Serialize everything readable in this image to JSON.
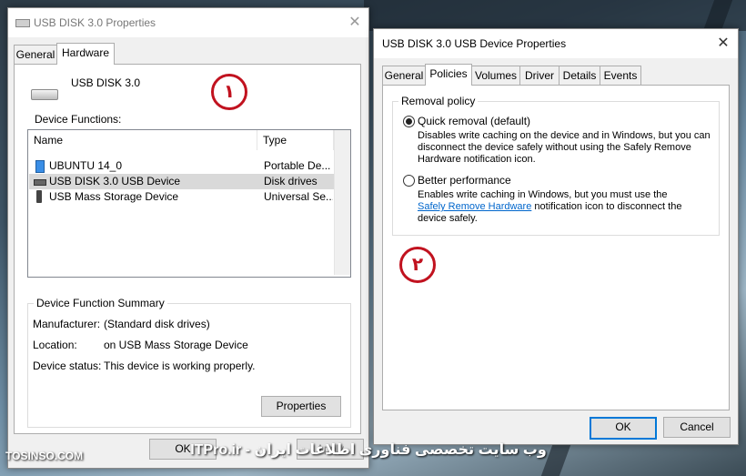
{
  "left_window": {
    "title": "USB DISK 3.0 Properties",
    "tabs": [
      "General",
      "Hardware"
    ],
    "device_name": "USB DISK 3.0",
    "device_functions_label": "Device Functions:",
    "columns": [
      "Name",
      "Type"
    ],
    "rows": [
      {
        "name": "UBUNTU 14_0",
        "type": "Portable De..."
      },
      {
        "name": "USB DISK 3.0 USB Device",
        "type": "Disk drives"
      },
      {
        "name": "USB Mass Storage Device",
        "type": "Universal Se..."
      }
    ],
    "summary_title": "Device Function Summary",
    "summary": [
      {
        "key": "Manufacturer:",
        "value": "(Standard disk drives)"
      },
      {
        "key": "Location:",
        "value": "on USB Mass Storage Device"
      },
      {
        "key": "Device status:",
        "value": "This device is working properly."
      }
    ],
    "properties_button": "Properties",
    "ok_button": "OK",
    "apply_button": "Apply"
  },
  "right_window": {
    "title": "USB DISK 3.0 USB Device Properties",
    "tabs": [
      "General",
      "Policies",
      "Volumes",
      "Driver",
      "Details",
      "Events"
    ],
    "removal_policy_label": "Removal policy",
    "quick_removal_label": "Quick removal (default)",
    "quick_removal_desc": [
      "Disables write caching on the device and in Windows, but you can",
      "disconnect the device safely without using the Safely Remove",
      "Hardware notification icon."
    ],
    "better_performance_label": "Better performance",
    "better_performance_desc_1": "Enables write caching in Windows, but you must use the",
    "better_performance_link": "Safely Remove Hardware",
    "better_performance_desc_2": " notification icon to disconnect the",
    "better_performance_desc_3": "device safely.",
    "ok_button": "OK",
    "cancel_button": "Cancel"
  },
  "annotations": {
    "circle_1": "١",
    "circle_2": "٢"
  },
  "footer": {
    "left": "TOSINSO.COM",
    "right": "وب سایت تخصصی فناوری اطلاعات ایران - ITPro.ir"
  },
  "colors": {
    "annotation_red": "#c1121f",
    "accent_blue": "#0078d7"
  },
  "icons": [
    "usb-drive-icon",
    "portable-device-icon",
    "disk-drive-icon",
    "usb-plug-icon",
    "close-icon"
  ]
}
